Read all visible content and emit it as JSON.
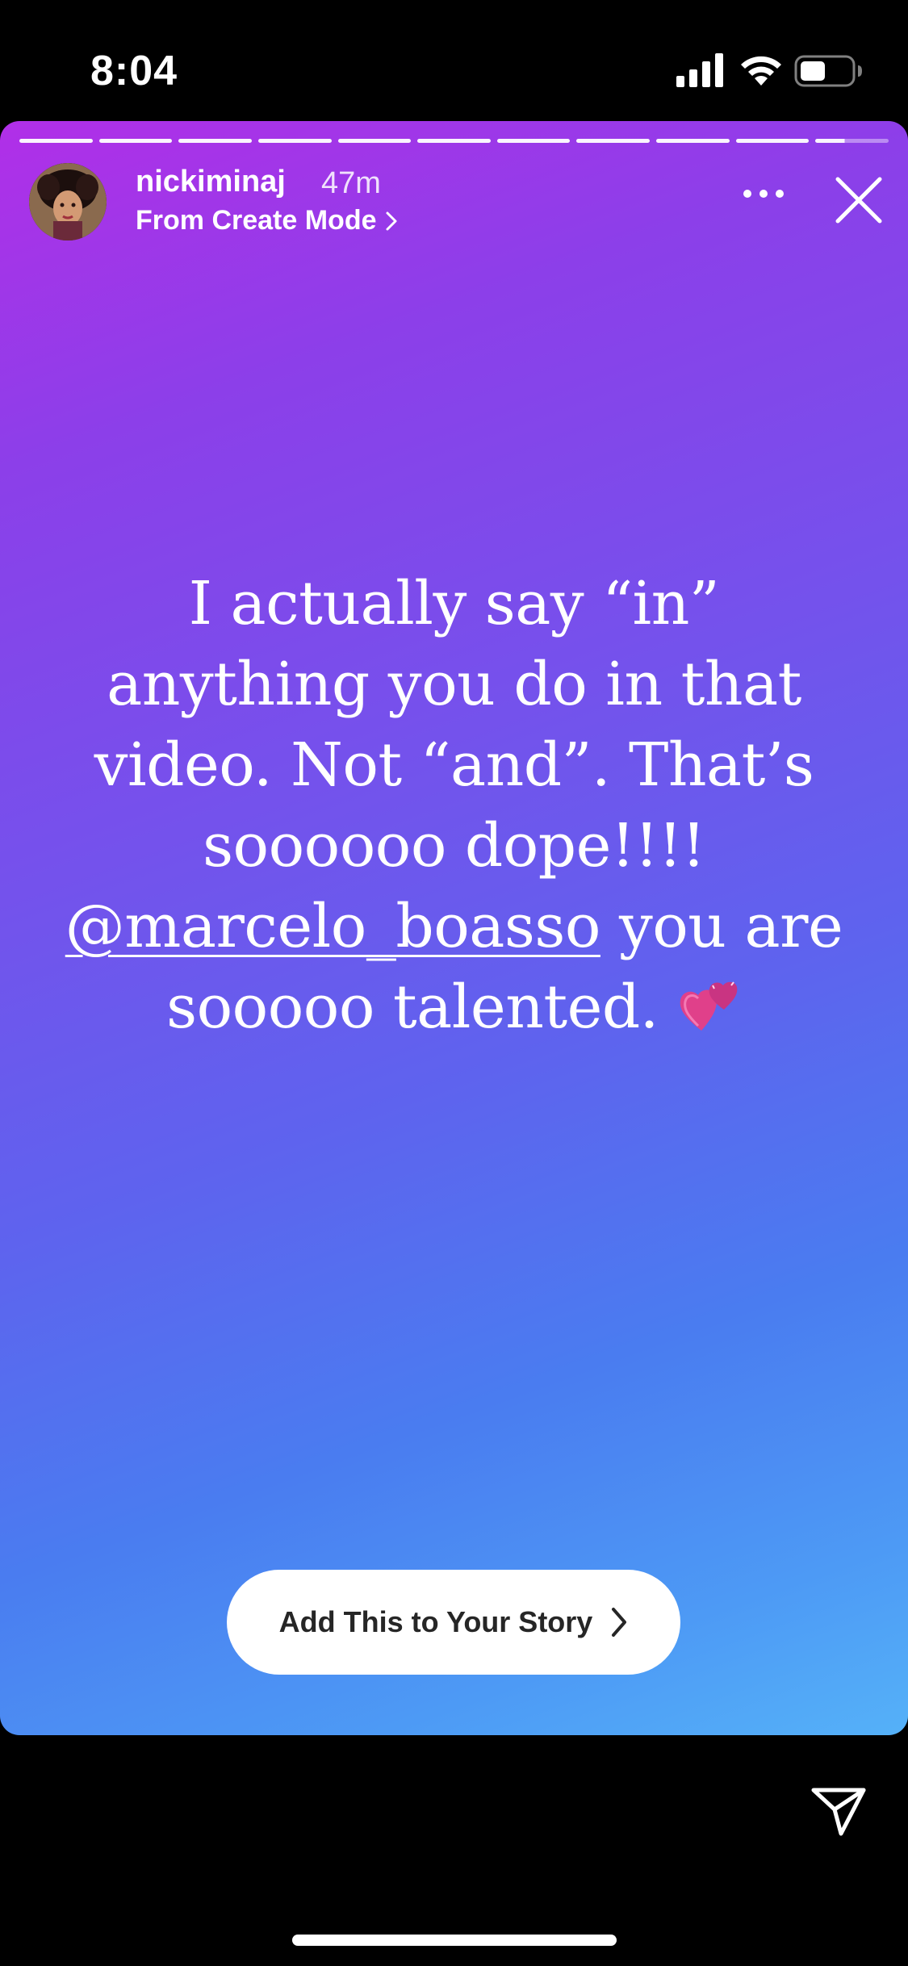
{
  "status_bar": {
    "time": "8:04",
    "icons": [
      "cellular-signal-icon",
      "wifi-icon",
      "battery-icon"
    ]
  },
  "story": {
    "progress_segments": 11,
    "current_segment_progress": 0.4,
    "username": "nickiminaj",
    "time_ago": "47m",
    "subtitle": "From Create Mode",
    "text": {
      "line_1": "I actually say “in”",
      "line_2": "anything you do in that",
      "line_3": "video. Not “and”. That’s",
      "line_4": "soooooo dope!!!!",
      "mention": "@marcelo_boasso",
      "line_5_rest": "you are",
      "line_6": "sooooo talented."
    },
    "emoji": "two-hearts",
    "background_colors": [
      "#b12fe8",
      "#7452ec",
      "#4a7cf0",
      "#55b1f8"
    ],
    "action_button": {
      "label": "Add This to Your Story"
    }
  },
  "bottom_bar": {
    "send_icon": "send-icon"
  }
}
